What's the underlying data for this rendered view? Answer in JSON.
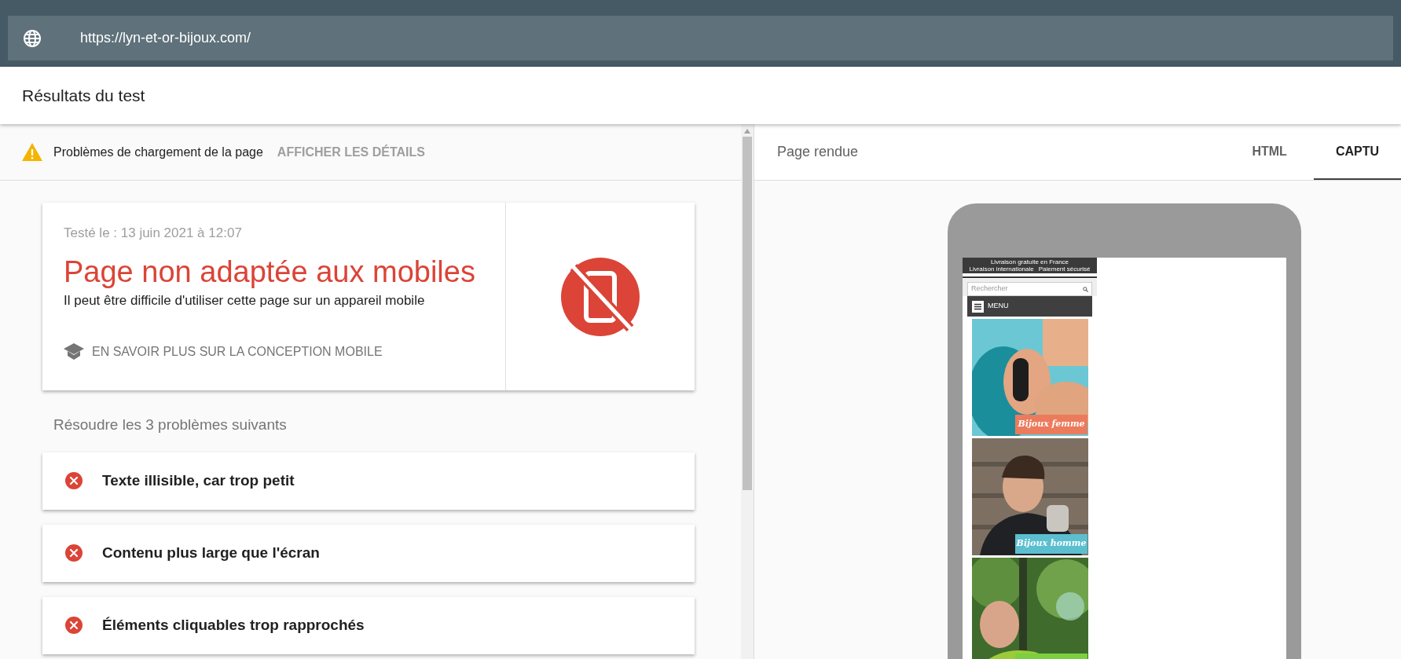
{
  "address_bar": {
    "url": "https://lyn-et-or-bijoux.com/"
  },
  "header": {
    "title": "Résultats du test"
  },
  "left_panel": {
    "alert": {
      "message": "Problèmes de chargement de la page",
      "action": "AFFICHER LES DÉTAILS"
    },
    "result_card": {
      "date": "Testé le : 13 juin 2021 à 12:07",
      "verdict": "Page non adaptée aux mobiles",
      "description": "Il peut être difficile d'utiliser cette page sur un appareil mobile",
      "link": "EN SAVOIR PLUS SUR LA CONCEPTION MOBILE"
    },
    "issues_title": "Résoudre les 3 problèmes suivants",
    "issues": [
      {
        "label": "Texte illisible, car trop petit"
      },
      {
        "label": "Contenu plus large que l'écran"
      },
      {
        "label": "Éléments cliquables trop rapprochés"
      }
    ]
  },
  "right_panel": {
    "title": "Page rendue",
    "tabs": [
      {
        "label": "HTML",
        "selected": false
      },
      {
        "label": "CAPTU",
        "selected": true
      }
    ],
    "preview": {
      "top_bar": [
        "Livraison gratuite en France",
        "Livraison internationale",
        "Paiement sécurisé"
      ],
      "search_placeholder": "Rechercher",
      "menu": "MENU",
      "banners": [
        {
          "caption": "Bijoux femme",
          "color": "#ec7a5c"
        },
        {
          "caption": "Bijoux homme",
          "color": "#5bbfd0"
        },
        {
          "color": "#7ccf3f"
        }
      ]
    }
  }
}
